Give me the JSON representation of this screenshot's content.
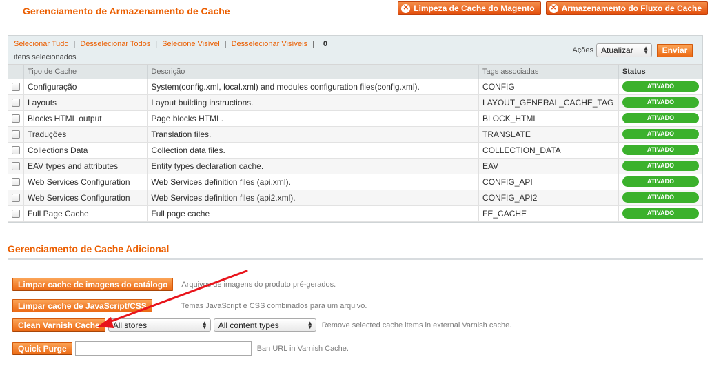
{
  "header": {
    "title": "Gerenciamento de Armazenamento de Cache",
    "buttons": [
      {
        "label": "Limpeza de Cache do Magento",
        "icon": "close-circle-icon"
      },
      {
        "label": "Armazenamento do Fluxo de Cache",
        "icon": "close-circle-icon"
      }
    ]
  },
  "massaction": {
    "links": [
      "Selecionar Tudo",
      "Desselecionar Todos",
      "Selecione Visível",
      "Desselecionar Visíveis"
    ],
    "separator": "|",
    "count": "0",
    "selected_text": "itens selecionados",
    "actions_label": "Ações",
    "action_select": "Atualizar",
    "submit": "Enviar"
  },
  "grid": {
    "columns": [
      "Tipo de Cache",
      "Descrição",
      "Tags associadas",
      "Status"
    ],
    "rows": [
      {
        "type": "Configuração",
        "desc": "System(config.xml, local.xml) and modules configuration files(config.xml).",
        "tags": "CONFIG",
        "status": "ATIVADO"
      },
      {
        "type": "Layouts",
        "desc": "Layout building instructions.",
        "tags": "LAYOUT_GENERAL_CACHE_TAG",
        "status": "ATIVADO"
      },
      {
        "type": "Blocks HTML output",
        "desc": "Page blocks HTML.",
        "tags": "BLOCK_HTML",
        "status": "ATIVADO"
      },
      {
        "type": "Traduções",
        "desc": "Translation files.",
        "tags": "TRANSLATE",
        "status": "ATIVADO"
      },
      {
        "type": "Collections Data",
        "desc": "Collection data files.",
        "tags": "COLLECTION_DATA",
        "status": "ATIVADO"
      },
      {
        "type": "EAV types and attributes",
        "desc": "Entity types declaration cache.",
        "tags": "EAV",
        "status": "ATIVADO"
      },
      {
        "type": "Web Services Configuration",
        "desc": "Web Services definition files (api.xml).",
        "tags": "CONFIG_API",
        "status": "ATIVADO"
      },
      {
        "type": "Web Services Configuration",
        "desc": "Web Services definition files (api2.xml).",
        "tags": "CONFIG_API2",
        "status": "ATIVADO"
      },
      {
        "type": "Full Page Cache",
        "desc": "Full page cache",
        "tags": "FE_CACHE",
        "status": "ATIVADO"
      }
    ]
  },
  "additional": {
    "title": "Gerenciamento de Cache Adicional",
    "catalog_images": {
      "button": "Limpar cache de imagens do catálogo",
      "hint": "Arquivos de imagens do produto pré-gerados."
    },
    "js_css": {
      "button": "Limpar cache de JavaScript/CSS",
      "hint": "Temas JavaScript e CSS combinados para um arquivo."
    },
    "varnish": {
      "button": "Clean Varnish Cache",
      "store_select": "All stores",
      "content_select": "All content types",
      "hint": "Remove selected cache items in external Varnish cache."
    },
    "purge": {
      "button": "Quick Purge",
      "input_value": "",
      "hint": "Ban URL in Varnish Cache."
    }
  },
  "colors": {
    "accent": "#eb5e00",
    "enabled": "#3bb12c",
    "annotation_arrow": "#e8141b"
  }
}
